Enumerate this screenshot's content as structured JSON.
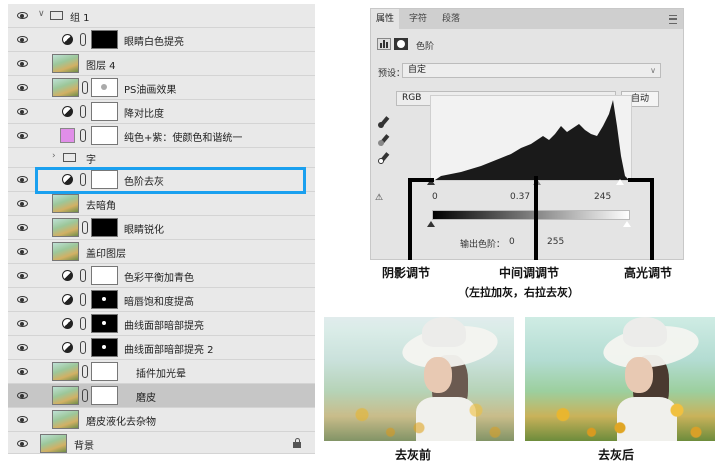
{
  "layers": [
    {
      "name": "组 1",
      "kind": "group",
      "expanded": true
    },
    {
      "name": "眼睛白色提亮",
      "kind": "adjustment",
      "mask": "black"
    },
    {
      "name": "图层 4",
      "kind": "photo"
    },
    {
      "name": "PS油画效果",
      "kind": "photo-mask",
      "mask": "spot"
    },
    {
      "name": "降对比度",
      "kind": "adjustment",
      "mask": "white"
    },
    {
      "name": "纯色+紫：使颜色和谐统一",
      "kind": "fill",
      "mask": "white",
      "swatch": "#e08ee8"
    },
    {
      "name": "字",
      "kind": "group",
      "expanded": false
    },
    {
      "name": "色阶去灰",
      "kind": "adjustment",
      "mask": "white",
      "highlighted": true
    },
    {
      "name": "去暗角",
      "kind": "photo"
    },
    {
      "name": "眼睛锐化",
      "kind": "photo-mask",
      "mask": "black"
    },
    {
      "name": "盖印图层",
      "kind": "photo"
    },
    {
      "name": "色彩平衡加青色",
      "kind": "adjustment",
      "mask": "white"
    },
    {
      "name": "暗唇饱和度提高",
      "kind": "adjustment",
      "mask": "dots"
    },
    {
      "name": "曲线面部暗部提亮",
      "kind": "adjustment",
      "mask": "dots"
    },
    {
      "name": "曲线面部暗部提亮 2",
      "kind": "adjustment",
      "mask": "dots"
    },
    {
      "name": "插件加光晕",
      "kind": "photo-mask-indent",
      "mask": "white"
    },
    {
      "name": "磨皮",
      "kind": "photo-mask",
      "mask": "white",
      "selected": true
    },
    {
      "name": "磨皮液化去杂物",
      "kind": "photo"
    },
    {
      "name": "背景",
      "kind": "background",
      "locked": true
    }
  ],
  "properties": {
    "tabs": [
      "属性",
      "字符",
      "段落"
    ],
    "active_tab": "属性",
    "title": "色阶",
    "preset_label": "预设：",
    "preset_value": "自定",
    "channel": "RGB",
    "auto_button": "自动",
    "input_levels": {
      "black": "0",
      "mid": "0.37",
      "white": "245"
    },
    "output_label": "输出色阶：",
    "output_levels": {
      "black": "0",
      "white": "255"
    },
    "icons": [
      "levels-icon",
      "mask-icon",
      "black-eyedropper-icon",
      "gray-eyedropper-icon",
      "white-eyedropper-icon",
      "clipping-warning-icon",
      "panel-menu-icon"
    ]
  },
  "annotations": {
    "shadow": "阴影调节",
    "midtone": "中间调调节",
    "midtone_note": "（左拉加灰，右拉去灰）",
    "highlight": "高光调节",
    "highlight_color": "#1aa0ef"
  },
  "comparison": {
    "before_label": "去灰前",
    "after_label": "去灰后"
  }
}
